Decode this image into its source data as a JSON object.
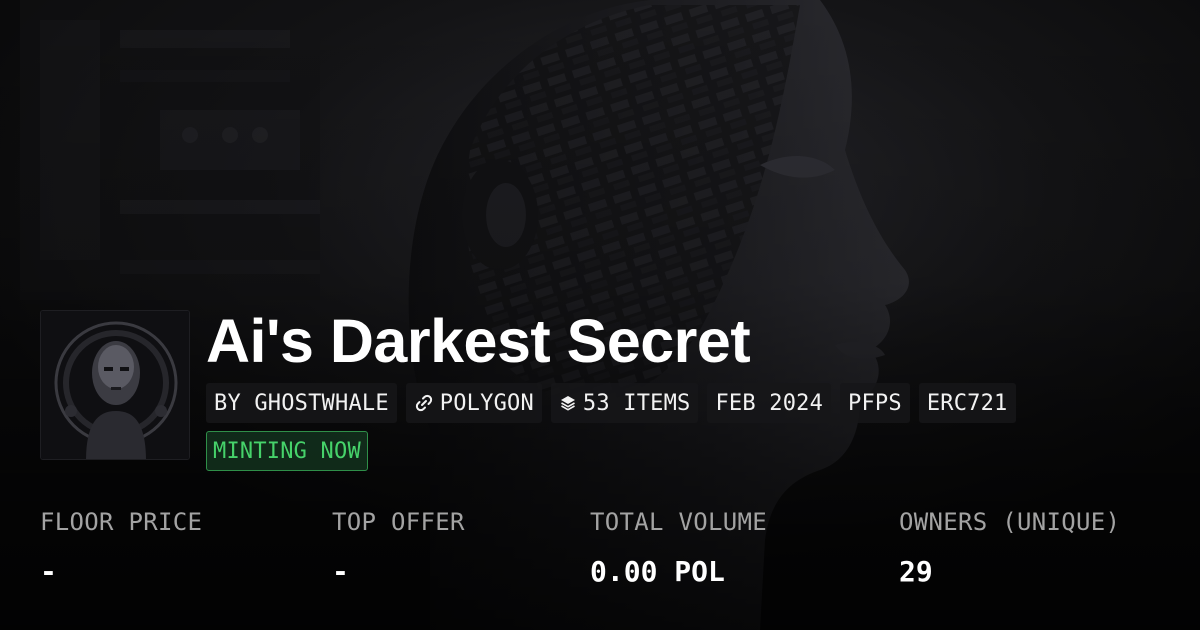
{
  "collection": {
    "title": "Ai's Darkest Secret",
    "tags": {
      "creator": "BY GHOSTWHALE",
      "chain": "POLYGON",
      "items": "53 ITEMS",
      "date": "FEB 2024",
      "category": "PFPS",
      "standard": "ERC721"
    },
    "status": "MINTING NOW",
    "status_color": "#46d26a"
  },
  "stats": [
    {
      "label": "FLOOR PRICE",
      "value": "-"
    },
    {
      "label": "TOP OFFER",
      "value": "-"
    },
    {
      "label": "TOTAL VOLUME",
      "value": "0.00 POL"
    },
    {
      "label": "OWNERS (UNIQUE)",
      "value": "29"
    }
  ],
  "icons": {
    "chain": "link-icon",
    "items": "layers-icon"
  },
  "theme": {
    "background": "#0a0a0b",
    "text": "#ffffff",
    "muted": "#a3a3a3"
  }
}
